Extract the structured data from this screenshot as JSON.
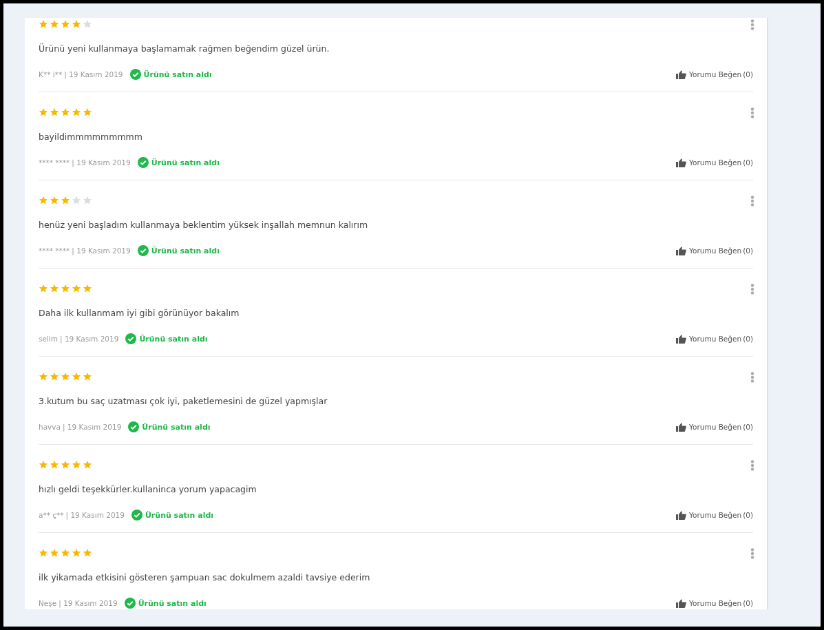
{
  "reviews": [
    {
      "stars": 4,
      "text": "Ürünü yeni kullanmaya başlamamak rağmen beğendim güzel ürün.",
      "author": "K** i**",
      "date": "| 19 Kasım 2019",
      "badge": "Ürünü satın aldı",
      "like": "Yorumu Beğen",
      "like_count": "(0)"
    },
    {
      "stars": 5,
      "text": "bayildimmmmmmmmm",
      "author": "**** ****",
      "date": "| 19 Kasım 2019",
      "badge": "Ürünü satın aldı",
      "like": "Yorumu Beğen",
      "like_count": "(0)"
    },
    {
      "stars": 3,
      "text": "henüz yeni başladım kullanmaya beklentim yüksek inşallah memnun kalırım",
      "author": "**** ****",
      "date": "| 19 Kasım 2019",
      "badge": "Ürünü satın aldı",
      "like": "Yorumu Beğen",
      "like_count": "(0)"
    },
    {
      "stars": 5,
      "text": "Daha ilk kullanmam iyi gibi görünüyor bakalım",
      "author": "selim",
      "date": "| 19 Kasım 2019",
      "badge": "Ürünü satın aldı",
      "like": "Yorumu Beğen",
      "like_count": "(0)"
    },
    {
      "stars": 5,
      "text": "3.kutum bu saç uzatması çok iyi, paketlemesini de güzel yapmışlar",
      "author": "havva",
      "date": "| 19 Kasım 2019",
      "badge": "Ürünü satın aldı",
      "like": "Yorumu Beğen",
      "like_count": "(0)"
    },
    {
      "stars": 5,
      "text": "hızlı geldi teşekkürler.kullaninca yorum yapacagim",
      "author": "a** ç**",
      "date": "| 19 Kasım 2019",
      "badge": "Ürünü satın aldı",
      "like": "Yorumu Beğen",
      "like_count": "(0)"
    },
    {
      "stars": 5,
      "text": "ilk yikamada etkisini gösteren şampuan sac dokulmem azaldi tavsiye ederim",
      "author": "Neşe",
      "date": "| 19 Kasım 2019",
      "badge": "Ürünü satın aldı",
      "like": "Yorumu Beğen",
      "like_count": "(0)"
    }
  ]
}
